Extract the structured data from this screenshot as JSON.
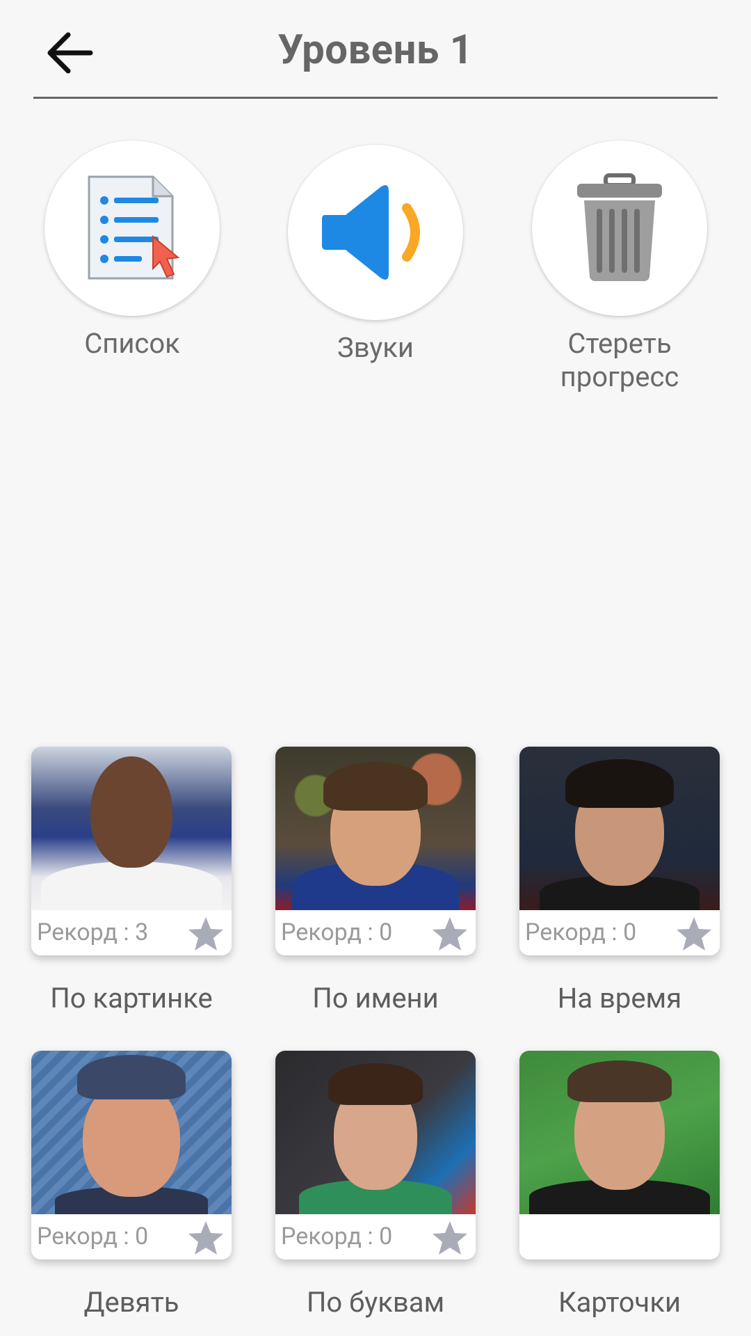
{
  "header": {
    "title": "Уровень 1",
    "back_icon": "arrow-left-icon"
  },
  "actions": [
    {
      "label": "Список",
      "icon": "list-document-icon"
    },
    {
      "label": "Звуки",
      "icon": "speaker-icon"
    },
    {
      "label_line1": "Стереть",
      "label_line2": "прогресс",
      "icon": "trash-can-icon"
    }
  ],
  "modes": [
    {
      "label": "По картинке",
      "record": "Рекорд : 3",
      "icon": "star-icon"
    },
    {
      "label": "По имени",
      "record": "Рекорд : 0",
      "icon": "star-icon"
    },
    {
      "label": "На время",
      "record": "Рекорд : 0",
      "icon": "star-icon"
    },
    {
      "label": "Девять",
      "record": "Рекорд : 0",
      "icon": "star-icon"
    },
    {
      "label": "По буквам",
      "record": "Рекорд : 0",
      "icon": "star-icon"
    },
    {
      "label": "Карточки",
      "record": ""
    }
  ],
  "colors": {
    "background": "#f7f7f8",
    "speaker_blue": "#1e88e5",
    "speaker_wave": "#f9a825",
    "star_gray": "#a9acb8"
  }
}
